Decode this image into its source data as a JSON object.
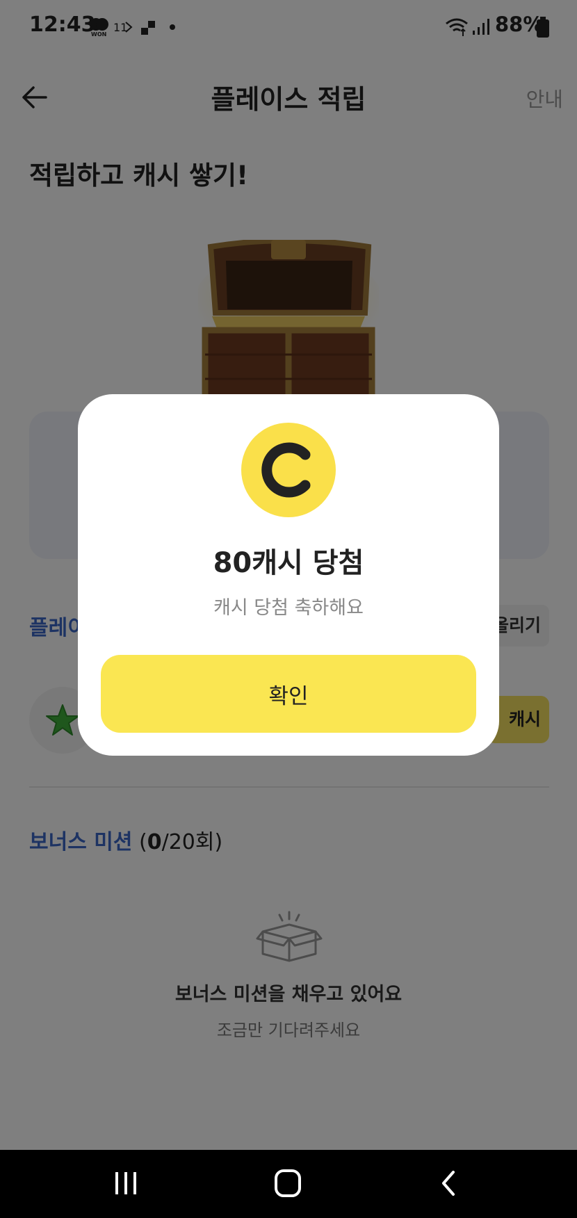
{
  "status_bar": {
    "time": "12:43",
    "battery": "88%",
    "indicators": [
      "won-icon",
      "11-icon",
      "app-icon",
      "dot-icon"
    ],
    "right_icons": [
      "wifi-icon",
      "signal-icon",
      "battery-icon"
    ]
  },
  "app_bar": {
    "title": "플레이스 적립",
    "help": "안내"
  },
  "headline": "적립하고 캐시 쌓기!",
  "section": {
    "place_label": "플레이",
    "share_label": "올리기",
    "cash_label": "캐시"
  },
  "bonus": {
    "title": "보너스 미션",
    "count_prefix": "(",
    "count_current": "0",
    "count_suffix": "/20회)"
  },
  "empty_state": {
    "title": "보너스 미션을 채우고 있어요",
    "subtitle": "조금만 기다려주세요"
  },
  "modal": {
    "coin_letter": "C",
    "title": "80캐시 당첨",
    "subtitle": "캐시 당첨 축하해요",
    "confirm": "확인"
  },
  "colors": {
    "accent_yellow": "#fae652",
    "link_blue": "#3a67c7"
  }
}
